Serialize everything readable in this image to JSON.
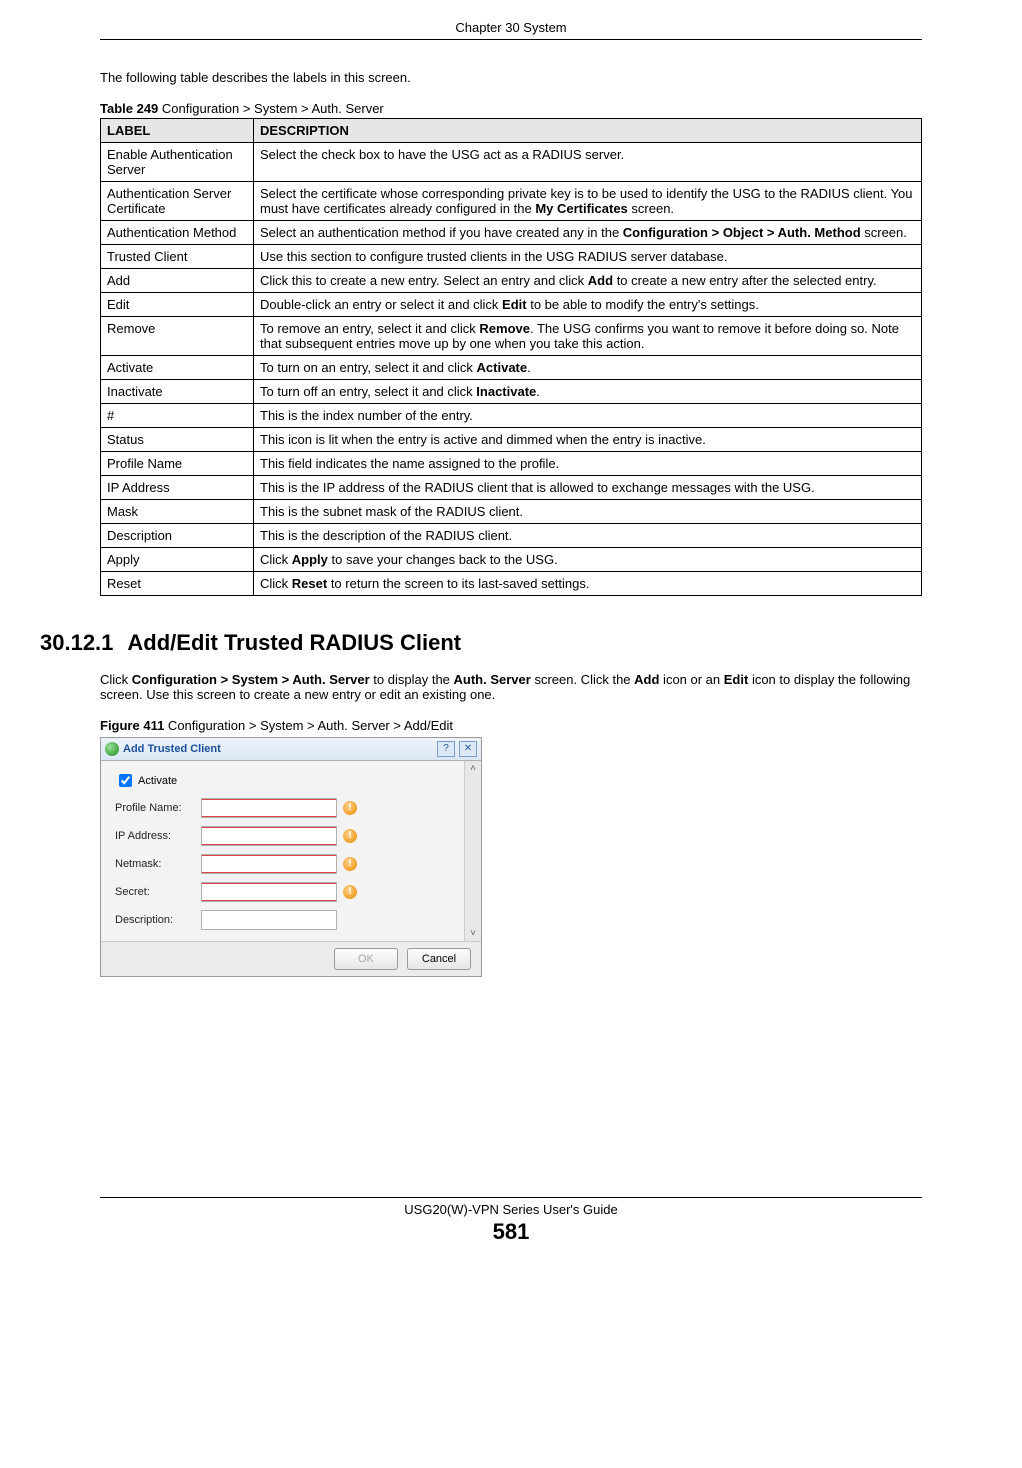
{
  "chapter_header": "Chapter 30 System",
  "intro": "The following table describes the labels in this screen.",
  "table_caption_prefix": "Table 249",
  "table_caption_text": "   Configuration > System > Auth. Server",
  "table_header_label": "LABEL",
  "table_header_desc": "DESCRIPTION",
  "rows": [
    {
      "label": "Enable Authentication Server",
      "desc": "Select the check box to have the USG act as a RADIUS server."
    },
    {
      "label": "Authentication Server Certificate",
      "desc": "Select the certificate whose corresponding private key is to be used to identify the USG to the RADIUS client. You must have certificates already configured in the <b>My Certificates</b> screen."
    },
    {
      "label": "Authentication Method",
      "desc": "Select an authentication method if you have created any in the <b>Configuration > Object > Auth. Method</b> screen."
    },
    {
      "label": "Trusted Client",
      "desc": " Use this section to configure trusted clients in the USG RADIUS server database."
    },
    {
      "label": "Add",
      "desc": "Click this to create a new entry. Select an entry and click <b>Add</b> to create a new entry after the selected entry."
    },
    {
      "label": "Edit",
      "desc": "Double-click an entry or select it and click <b>Edit</b> to be able to modify the entry's settings."
    },
    {
      "label": "Remove",
      "desc": "To remove an entry, select it and click <b>Remove</b>. The USG confirms you want to remove it before doing so. Note that subsequent entries move up by one when you take this action."
    },
    {
      "label": "Activate",
      "desc": "To turn on an entry, select it and click <b>Activate</b>."
    },
    {
      "label": "Inactivate",
      "desc": "To turn off an entry, select it and click <b>Inactivate</b>."
    },
    {
      "label": "#",
      "desc": "This is the index number of the entry."
    },
    {
      "label": "Status",
      "desc": "This icon is lit when the entry is active and dimmed when the entry is inactive."
    },
    {
      "label": "Profile Name",
      "desc": "This field indicates the name assigned to the profile."
    },
    {
      "label": "IP Address",
      "desc": "This is the IP address of the RADIUS client that is allowed to exchange messages with the USG."
    },
    {
      "label": "Mask",
      "desc": "This is the subnet mask of the RADIUS client."
    },
    {
      "label": "Description",
      "desc": "This is the description of the RADIUS client."
    },
    {
      "label": "Apply",
      "desc": "Click <b>Apply</b> to save your changes back to the USG."
    },
    {
      "label": "Reset",
      "desc": "Click <b>Reset</b> to return the screen to its last-saved settings."
    }
  ],
  "section_number": "30.12.1",
  "section_title": "Add/Edit Trusted RADIUS Client",
  "section_para": "Click <b>Configuration > System > Auth. Server</b> to display the <b>Auth. Server</b> screen. Click the <b>Add</b> icon or an <b>Edit</b> icon to display the following screen. Use this screen to create a new entry or edit an existing one.",
  "figure_caption_prefix": "Figure 411",
  "figure_caption_text": "   Configuration > System > Auth. Server > Add/Edit",
  "dialog": {
    "title": "Add Trusted Client",
    "help_glyph": "?",
    "close_glyph": "✕",
    "activate_label": "Activate",
    "fields": {
      "profile": "Profile Name:",
      "ip": "IP Address:",
      "netmask": "Netmask:",
      "secret": "Secret:",
      "description": "Description:"
    },
    "ok": "OK",
    "cancel": "Cancel",
    "warn_glyph": "!"
  },
  "footer_guide": "USG20(W)-VPN Series User's Guide",
  "page_number": "581"
}
